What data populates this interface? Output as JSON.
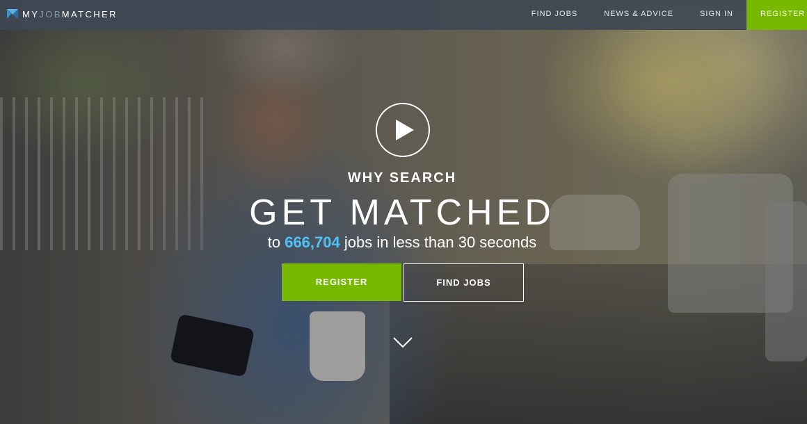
{
  "brand": {
    "name_prefix": "MY",
    "name_highlight": "JOB",
    "name_suffix": "MATCHER",
    "accent_color": "#76b900",
    "highlight_color": "#4fc3f7"
  },
  "nav": {
    "items": [
      {
        "label": "FIND JOBS"
      },
      {
        "label": "NEWS & ADVICE"
      },
      {
        "label": "SIGN IN"
      },
      {
        "label": "REGISTER"
      }
    ]
  },
  "hero": {
    "play_icon": "play-icon",
    "eyebrow": "WHY SEARCH",
    "headline": "GET MATCHED",
    "sub_prefix": "to ",
    "job_count": "666,704",
    "sub_suffix": " jobs in less than 30 seconds",
    "register_label": "REGISTER",
    "find_jobs_label": "FIND JOBS",
    "scroll_icon": "chevron-down-icon"
  }
}
